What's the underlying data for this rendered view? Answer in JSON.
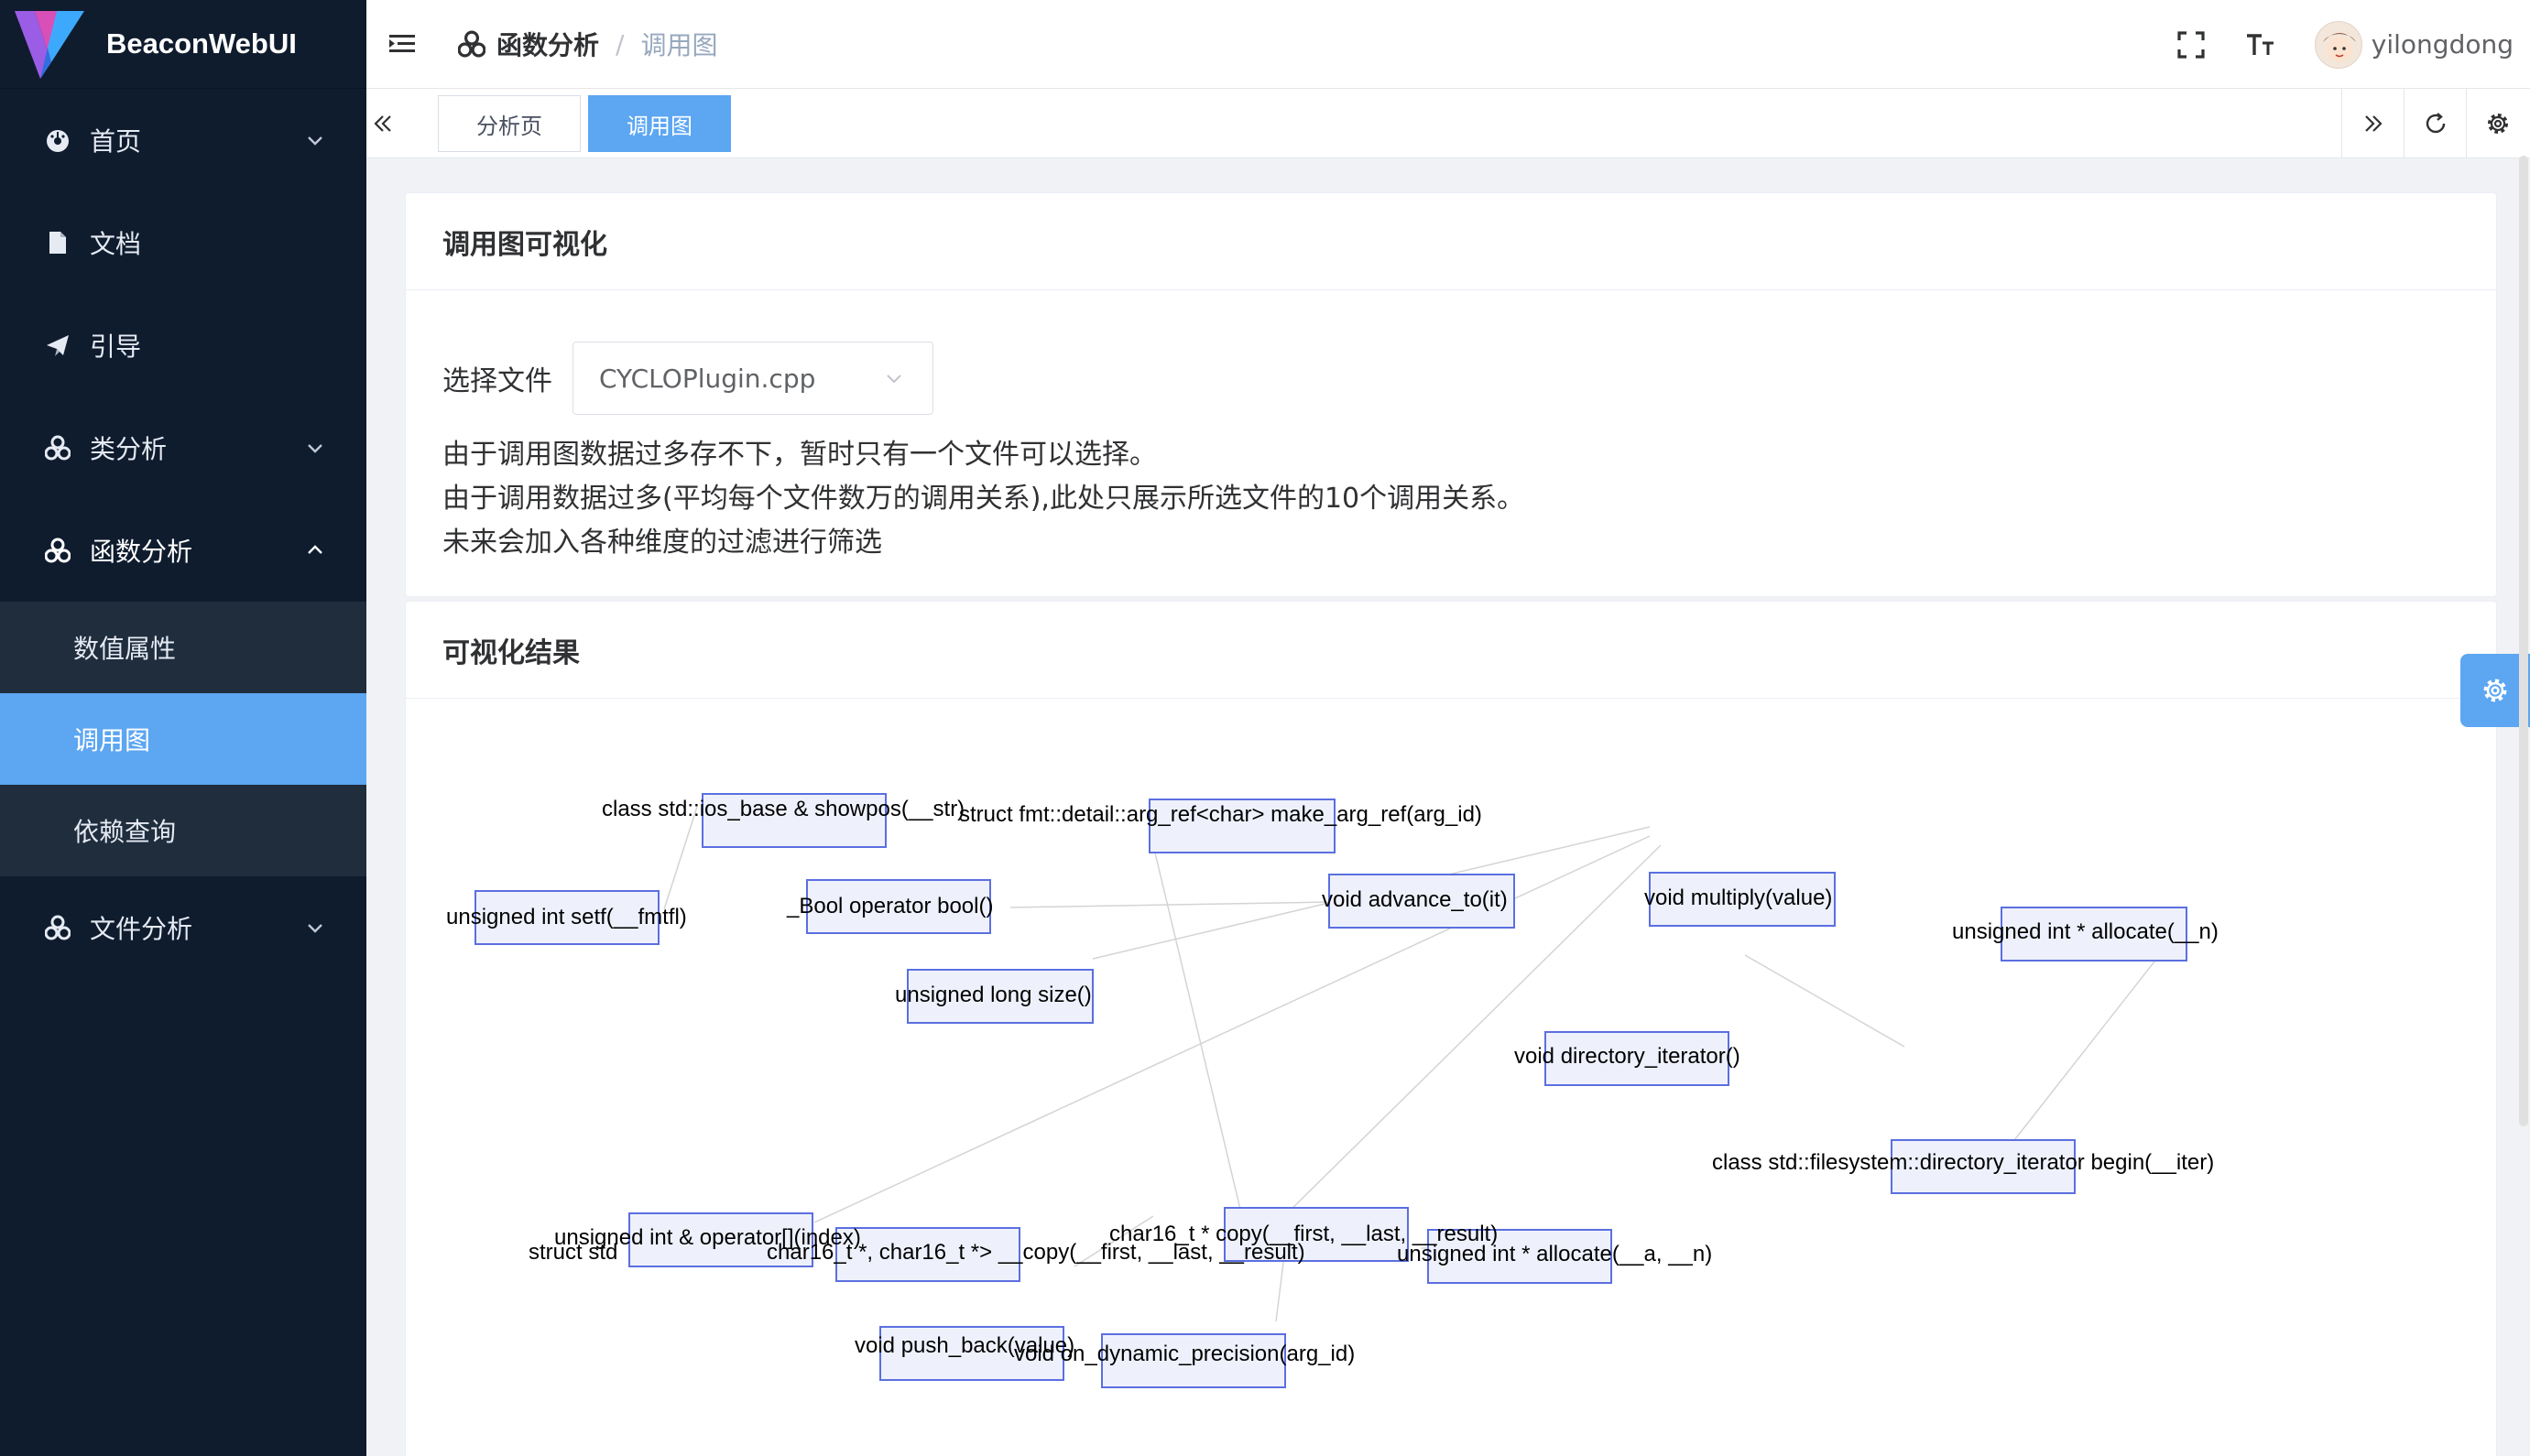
{
  "app": {
    "title": "BeaconWebUI"
  },
  "sidebar": {
    "items": [
      {
        "label": "首页",
        "icon": "dashboard-icon"
      },
      {
        "label": "文档",
        "icon": "document-icon"
      },
      {
        "label": "引导",
        "icon": "guide-icon"
      },
      {
        "label": "类分析",
        "icon": "cluster-icon"
      },
      {
        "label": "函数分析",
        "icon": "cluster-icon"
      },
      {
        "label": "文件分析",
        "icon": "cluster-icon"
      }
    ],
    "submenu": [
      {
        "label": "数值属性"
      },
      {
        "label": "调用图"
      },
      {
        "label": "依赖查询"
      }
    ]
  },
  "breadcrumb": {
    "parent": "函数分析",
    "current": "调用图"
  },
  "user": {
    "name": "yilongdong"
  },
  "tags": [
    {
      "label": "分析页"
    },
    {
      "label": "调用图"
    }
  ],
  "card1": {
    "title": "调用图可视化",
    "file_label": "选择文件",
    "file_value": "CYCLOPlugin.cpp",
    "notes": [
      "由于调用图数据过多存不下，暂时只有一个文件可以选择。",
      "由于调用数据过多(平均每个文件数万的调用关系),此处只展示所选文件的10个调用关系。",
      "未来会加入各种维度的过滤进行筛选"
    ]
  },
  "card2": {
    "title": "可视化结果"
  },
  "graph": {
    "labels": [
      "class std::ios_base & showpos(__str)",
      "struct fmt::detail::arg_ref<char> make_arg_ref(arg_id)",
      "unsigned int setf(__fmtfl)",
      "_Bool operator bool()",
      "void advance_to(it)",
      "void multiply(value)",
      "unsigned long size()",
      "unsigned int * allocate(__n)",
      "void directory_iterator()",
      "class std::filesystem::directory_iterator begin(__iter)",
      "unsigned int & operator[](index)",
      "struct std",
      "char16_t *, char16_t *> __copy(__first, __last, __result)",
      "char16_t * copy(__first, __last, __result)",
      "unsigned int * allocate(__a, __n)",
      "void push_back(value)",
      "void on_dynamic_precision(arg_id)"
    ]
  },
  "colors": {
    "sidebar": "#0f1c2e",
    "submenu": "#1f2d3d",
    "accent": "#5ca6f2",
    "node_border": "#5b6fe0",
    "node_fill": "#eef1fc"
  }
}
